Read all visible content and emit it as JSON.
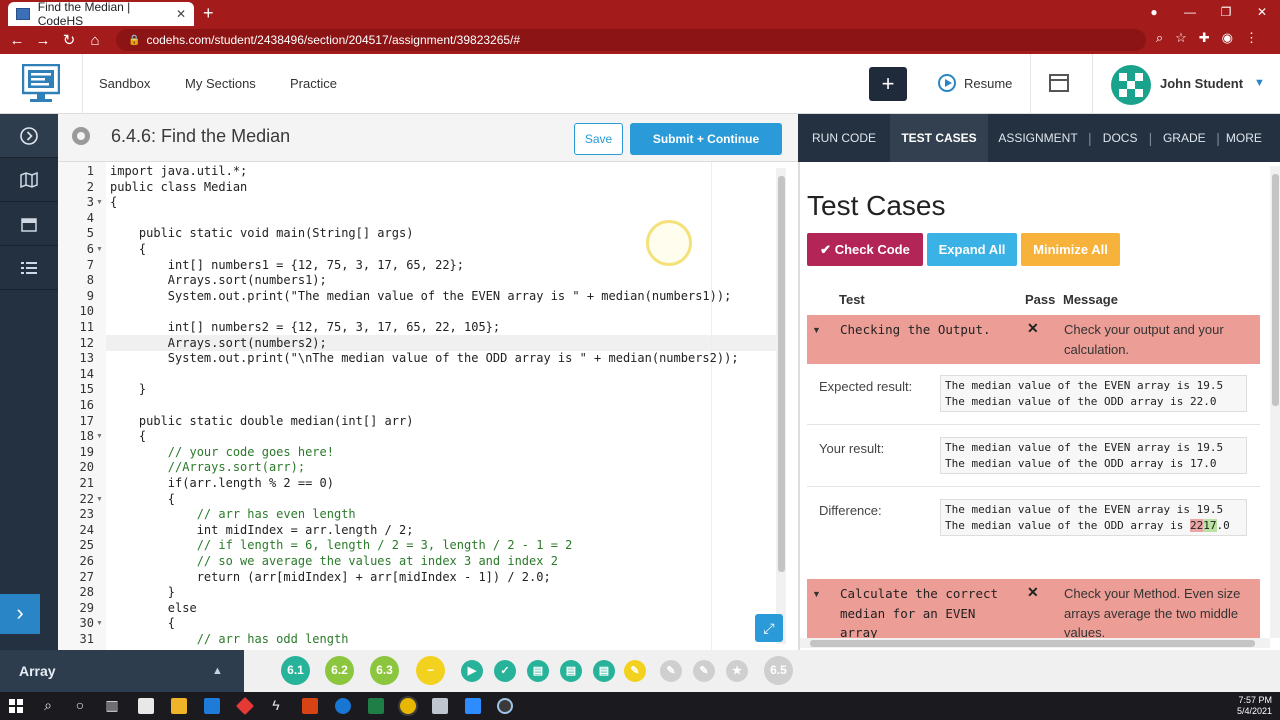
{
  "browser": {
    "tab_title": "Find the Median | CodeHS",
    "url": "codehs.com/student/2438496/section/204517/assignment/39823265/#"
  },
  "header": {
    "nav": [
      "Sandbox",
      "My Sections",
      "Practice"
    ],
    "plus_label": "+",
    "resume_label": "Resume",
    "user_name": "John Student"
  },
  "editor": {
    "title": "6.4.6: Find the Median",
    "save_label": "Save",
    "submit_label": "Submit + Continue",
    "lines": [
      {
        "n": "1",
        "text": "import java.util.*;",
        "type": "code"
      },
      {
        "n": "2",
        "text": "public class Median",
        "type": "code"
      },
      {
        "n": "3",
        "text": "{",
        "type": "code"
      },
      {
        "n": "4",
        "text": "",
        "type": "code"
      },
      {
        "n": "5",
        "text": "    public static void main(String[] args)",
        "type": "code"
      },
      {
        "n": "6",
        "text": "    {",
        "type": "code"
      },
      {
        "n": "7",
        "text": "        int[] numbers1 = {12, 75, 3, 17, 65, 22};",
        "type": "code"
      },
      {
        "n": "8",
        "text": "        Arrays.sort(numbers1);",
        "type": "code"
      },
      {
        "n": "9",
        "text": "        System.out.print(\"The median value of the EVEN array is \" + median(numbers1));",
        "type": "code"
      },
      {
        "n": "10",
        "text": "",
        "type": "code"
      },
      {
        "n": "11",
        "text": "        int[] numbers2 = {12, 75, 3, 17, 65, 22, 105};",
        "type": "code"
      },
      {
        "n": "12",
        "text": "        Arrays.sort(numbers2);",
        "type": "code"
      },
      {
        "n": "13",
        "text": "        System.out.print(\"\\nThe median value of the ODD array is \" + median(numbers2));",
        "type": "code"
      },
      {
        "n": "14",
        "text": "",
        "type": "code"
      },
      {
        "n": "15",
        "text": "    }",
        "type": "code"
      },
      {
        "n": "16",
        "text": "",
        "type": "code"
      },
      {
        "n": "17",
        "text": "    public static double median(int[] arr)",
        "type": "code"
      },
      {
        "n": "18",
        "text": "    {",
        "type": "code"
      },
      {
        "n": "19",
        "text": "        // your code goes here!",
        "type": "comment"
      },
      {
        "n": "20",
        "text": "        //Arrays.sort(arr);",
        "type": "comment"
      },
      {
        "n": "21",
        "text": "        if(arr.length % 2 == 0)",
        "type": "code"
      },
      {
        "n": "22",
        "text": "        {",
        "type": "code"
      },
      {
        "n": "23",
        "text": "            // arr has even length",
        "type": "comment"
      },
      {
        "n": "24",
        "text": "            int midIndex = arr.length / 2;",
        "type": "code"
      },
      {
        "n": "25",
        "text": "            // if length = 6, length / 2 = 3, length / 2 - 1 = 2",
        "type": "comment"
      },
      {
        "n": "26",
        "text": "            // so we average the values at index 3 and index 2",
        "type": "comment"
      },
      {
        "n": "27",
        "text": "            return (arr[midIndex] + arr[midIndex - 1]) / 2.0;",
        "type": "code"
      },
      {
        "n": "28",
        "text": "        }",
        "type": "code"
      },
      {
        "n": "29",
        "text": "        else",
        "type": "code"
      },
      {
        "n": "30",
        "text": "        {",
        "type": "code"
      },
      {
        "n": "31",
        "text": "            // arr has odd length",
        "type": "comment"
      }
    ]
  },
  "right_panel": {
    "tabs": [
      "RUN CODE",
      "TEST CASES",
      "ASSIGNMENT",
      "DOCS",
      "GRADE",
      "MORE"
    ],
    "active_tab": "TEST CASES",
    "title": "Test Cases",
    "check_label": "Check Code",
    "expand_label": "Expand All",
    "minimize_label": "Minimize All",
    "col_test": "Test",
    "col_pass": "Pass",
    "col_message": "Message",
    "test1": {
      "name": "Checking the Output.",
      "pass": "✕",
      "message": "Check your output and your calculation.",
      "expected_label": "Expected result:",
      "expected": [
        "The median value of the EVEN array is 19.5",
        "The median value of the ODD array is 22.0"
      ],
      "yours_label": "Your result:",
      "yours": [
        "The median value of the EVEN array is 19.5",
        "The median value of the ODD array is 17.0"
      ],
      "diff_label": "Difference:",
      "diff_line1": "The median value of the EVEN array is 19.5",
      "diff_prefix": "The median value of the ODD array is ",
      "diff_removed": "22",
      "diff_added": "17",
      "diff_suffix": ".0"
    },
    "test2": {
      "name": "Calculate the correct median for an EVEN array",
      "pass": "✕",
      "message": "Check your Method. Even size arrays average the two middle values."
    }
  },
  "bottom": {
    "module": "Array",
    "items": [
      {
        "label": "6.1",
        "color": "#27b39a"
      },
      {
        "label": "6.2",
        "color": "#8cc63f"
      },
      {
        "label": "6.3",
        "color": "#8cc63f"
      },
      {
        "label": "",
        "color": "#f2d21e"
      },
      {
        "label": "",
        "color": "#27b39a"
      },
      {
        "label": "",
        "color": "#27b39a"
      },
      {
        "label": "",
        "color": "#27b39a"
      },
      {
        "label": "",
        "color": "#27b39a"
      },
      {
        "label": "",
        "color": "#27b39a"
      },
      {
        "label": "",
        "color": "#f2d21e"
      },
      {
        "label": "",
        "color": "#cfcfcf"
      },
      {
        "label": "",
        "color": "#cfcfcf"
      },
      {
        "label": "",
        "color": "#cfcfcf"
      },
      {
        "label": "6.5",
        "color": "#cfcfcf"
      }
    ]
  },
  "taskbar": {
    "time": "7:57 PM",
    "date": "5/4/2021"
  }
}
